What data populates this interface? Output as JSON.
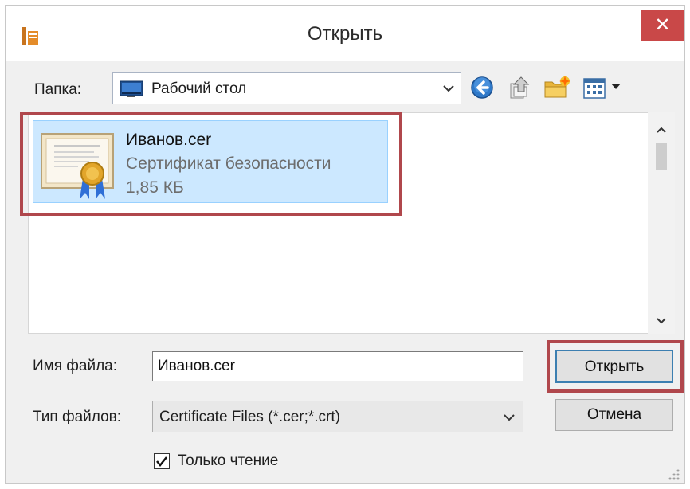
{
  "window": {
    "title": "Открыть",
    "close_glyph": "✕"
  },
  "toolbar": {
    "folder_label": "Папка:",
    "folder_value": "Рабочий стол",
    "buttons": [
      "back-icon",
      "up-folder-icon",
      "new-folder-icon",
      "view-menu-icon"
    ]
  },
  "file_list": {
    "items": [
      {
        "name": "Иванов.cer",
        "type": "Сертификат безопасности",
        "size": "1,85 КБ",
        "icon": "certificate-icon",
        "selected": true
      }
    ]
  },
  "form": {
    "filename_label": "Имя файла:",
    "filename_value": "Иванов.cer",
    "filetype_label": "Тип файлов:",
    "filetype_value": "Certificate Files (*.cer;*.crt)",
    "readonly_label": "Только чтение",
    "readonly_checked": true
  },
  "buttons": {
    "open": "Открыть",
    "cancel": "Отмена"
  },
  "colors": {
    "highlight_border": "#b0474c",
    "selection_bg": "#cce8ff",
    "close_bg": "#c94848"
  }
}
